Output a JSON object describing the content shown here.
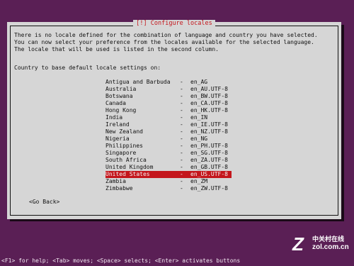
{
  "dialog": {
    "title": "[!] Configure locales",
    "message": "There is no locale defined for the combination of language and country you have selected.\nYou can now select your preference from the locales available for the selected language.\nThe locale that will be used is listed in the second column.",
    "prompt": "Country to base default locale settings on:",
    "items": [
      {
        "country": "Antigua and Barbuda",
        "sep": "-",
        "locale": "en_AG"
      },
      {
        "country": "Australia",
        "sep": "-",
        "locale": "en_AU.UTF-8"
      },
      {
        "country": "Botswana",
        "sep": "-",
        "locale": "en_BW.UTF-8"
      },
      {
        "country": "Canada",
        "sep": "-",
        "locale": "en_CA.UTF-8"
      },
      {
        "country": "Hong Kong",
        "sep": "-",
        "locale": "en_HK.UTF-8"
      },
      {
        "country": "India",
        "sep": "-",
        "locale": "en_IN"
      },
      {
        "country": "Ireland",
        "sep": "-",
        "locale": "en_IE.UTF-8"
      },
      {
        "country": "New Zealand",
        "sep": "-",
        "locale": "en_NZ.UTF-8"
      },
      {
        "country": "Nigeria",
        "sep": "-",
        "locale": "en_NG"
      },
      {
        "country": "Philippines",
        "sep": "-",
        "locale": "en_PH.UTF-8"
      },
      {
        "country": "Singapore",
        "sep": "-",
        "locale": "en_SG.UTF-8"
      },
      {
        "country": "South Africa",
        "sep": "-",
        "locale": "en_ZA.UTF-8"
      },
      {
        "country": "United Kingdom",
        "sep": "-",
        "locale": "en_GB.UTF-8"
      },
      {
        "country": "United States",
        "sep": "-",
        "locale": "en_US.UTF-8"
      },
      {
        "country": "Zambia",
        "sep": "-",
        "locale": "en_ZM"
      },
      {
        "country": "Zimbabwe",
        "sep": "-",
        "locale": "en_ZW.UTF-8"
      }
    ],
    "selected_index": 13,
    "back_button": "<Go Back>"
  },
  "help_bar": "<F1> for help; <Tab> moves; <Space> selects; <Enter> activates buttons",
  "watermark": {
    "logo": "Z",
    "name": "中关村在线",
    "url": "zol.com.cn"
  },
  "colors": {
    "background": "#5a1f55",
    "dialog": "#d6d6d6",
    "highlight": "#c4161c"
  }
}
